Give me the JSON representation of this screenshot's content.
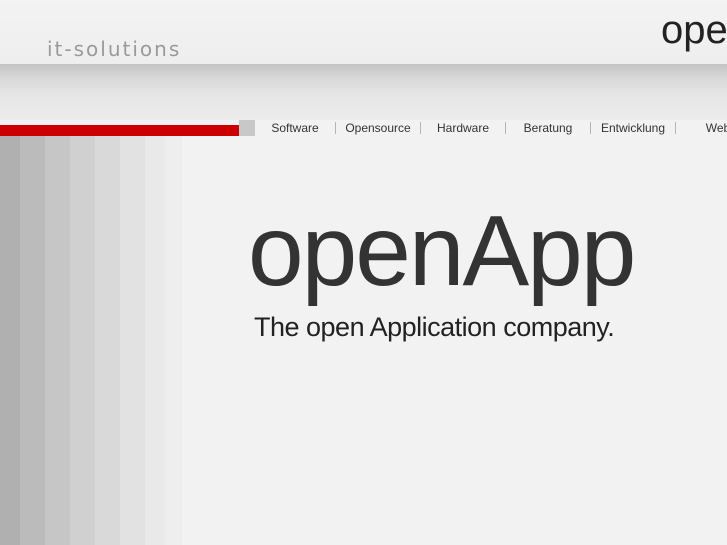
{
  "header": {
    "tagline": "it-solutions",
    "brand_partial": "ope"
  },
  "nav": {
    "items": [
      {
        "label": "Software"
      },
      {
        "label": "Opensource"
      },
      {
        "label": "Hardware"
      },
      {
        "label": "Beratung"
      },
      {
        "label": "Entwicklung"
      },
      {
        "label": "Web"
      }
    ]
  },
  "hero": {
    "logo": "openApp",
    "slogan": "The open Application company."
  },
  "colors": {
    "accent": "#cc0000",
    "background": "#f1f2f1",
    "text": "#333333",
    "tagline": "#9a9a9a"
  }
}
